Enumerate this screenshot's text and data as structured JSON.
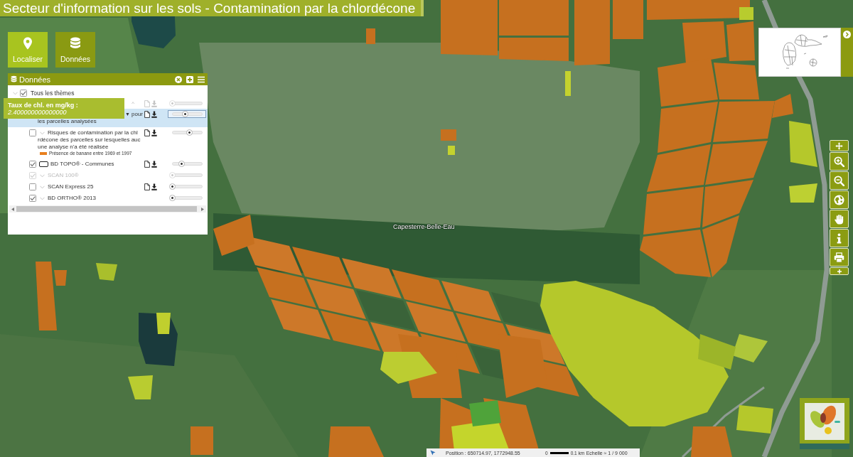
{
  "title": "Secteur d'information sur les sols - Contamination par la chlordécone",
  "map_buttons": [
    {
      "kind": "locate",
      "label": "Localiser",
      "selected": false
    },
    {
      "kind": "data",
      "label": "Données",
      "selected": true
    }
  ],
  "data_panel": {
    "title": "Données",
    "root": {
      "label": "Tous les thèmes",
      "checked": true
    },
    "layers": [
      {
        "kind": "covered",
        "marker": "^",
        "selected": false,
        "disabled": true,
        "tools": true,
        "level": 0
      },
      {
        "kind": "covered",
        "marker": "▼",
        "lines": [
          "pour",
          "les parcelles analysées"
        ],
        "selected": true,
        "disabled": false,
        "tools": true,
        "level": 0.44
      },
      {
        "kind": "group",
        "checked": false,
        "disabled": false,
        "lines": [
          "Risques de contamination par la chl",
          "rdécone des parcelles sur lesquelles auc",
          "une analyse n'a été réalisée"
        ],
        "legend": [
          {
            "color": "#e8801e",
            "label": "Présence de banane entre 1969 et 1997"
          }
        ],
        "selected": false,
        "tools": true,
        "level": 0.58
      },
      {
        "kind": "layer",
        "checked": true,
        "disabled": false,
        "lines": [
          "BD TOPO® - Communes"
        ],
        "selected": false,
        "tools": true,
        "level": 0.3
      },
      {
        "kind": "group",
        "checked": true,
        "disabled": true,
        "lines": [
          "SCAN 100®"
        ],
        "selected": false,
        "tools": false,
        "level": 0
      },
      {
        "kind": "group",
        "checked": false,
        "disabled": false,
        "lines": [
          "SCAN Express 25"
        ],
        "selected": false,
        "tools": true,
        "level": 0
      },
      {
        "kind": "group",
        "checked": true,
        "disabled": false,
        "lines": [
          "BD ORTHO® 2013"
        ],
        "selected": false,
        "tools": false,
        "level": 0
      }
    ],
    "tooltip": {
      "label": "Taux de chl. en mg/kg :",
      "value": "2.400000000000000"
    }
  },
  "map": {
    "place_label": "Capesterre-Belle-Eau"
  },
  "map_tools": [
    {
      "kind": "pan"
    },
    {
      "kind": "zoom_in"
    },
    {
      "kind": "zoom_out"
    },
    {
      "kind": "globe"
    },
    {
      "kind": "hand"
    },
    {
      "kind": "info"
    },
    {
      "kind": "print"
    },
    {
      "kind": "more"
    }
  ],
  "status_bar": {
    "position": "Position : 650714.97, 1772948.55",
    "scale_start": "0",
    "scale_end": "0.1 km",
    "scale": "Echelle ≈ 1 / 9 000"
  }
}
